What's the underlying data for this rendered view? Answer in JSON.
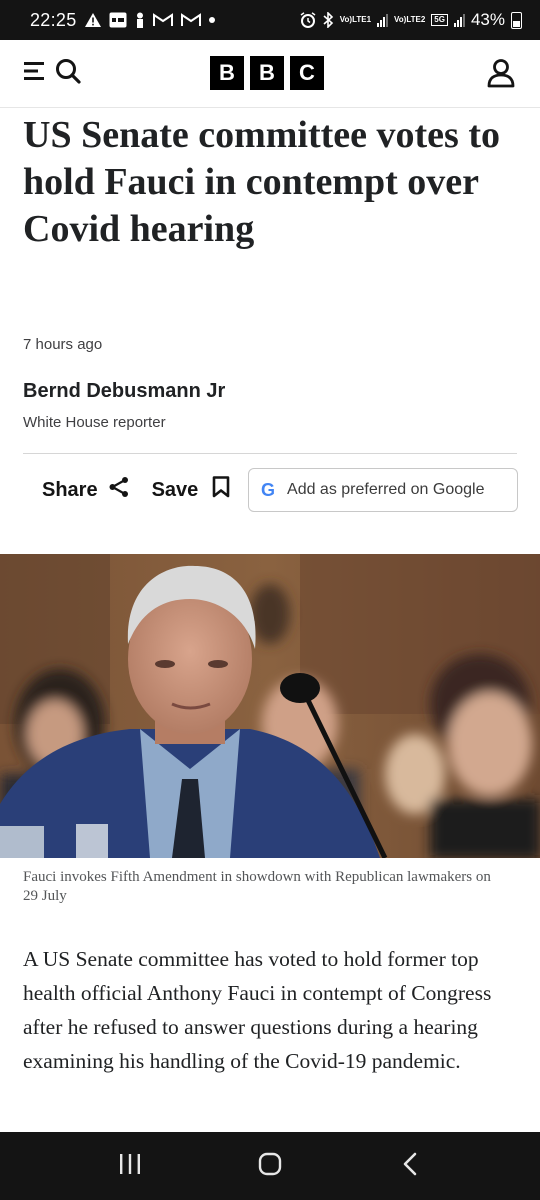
{
  "status_bar": {
    "time": "22:25",
    "battery": "43%",
    "sim1_label": "LTE1",
    "sim2_label": "LTE2",
    "network": "5G"
  },
  "header": {
    "logo_letters": [
      "B",
      "B",
      "C"
    ]
  },
  "article": {
    "headline": "US Senate committee votes to hold Fauci in contempt over Covid hearing",
    "timestamp": "7 hours ago",
    "author_name": "Bernd Debusmann Jr",
    "author_role": "White House reporter",
    "share_label": "Share",
    "save_label": "Save",
    "google_button_label": "Add as preferred on Google",
    "google_logo_letter": "G",
    "image_caption": "Fauci invokes Fifth Amendment in showdown with Republican lawmakers on 29 July",
    "body_paragraph": "A US Senate committee has voted to hold former top health official Anthony Fauci in contempt of Congress after he refused to answer questions during a hearing examining his handling of the Covid-19 pandemic."
  },
  "colors": {
    "status_bar_bg": "#141414",
    "headline": "#202224",
    "google_blue": "#4285f4"
  }
}
